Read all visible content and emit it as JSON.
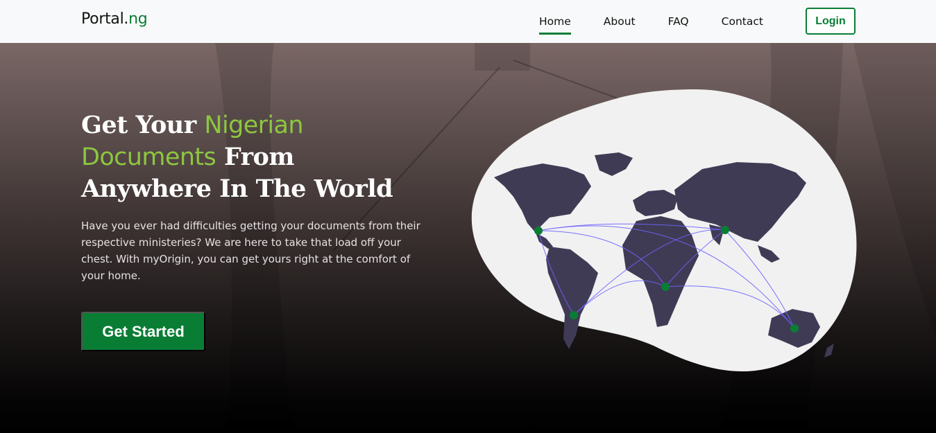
{
  "brand": {
    "name_main": "Portal.",
    "name_accent": "ng"
  },
  "nav": {
    "items": [
      {
        "label": "Home",
        "active": true
      },
      {
        "label": "About",
        "active": false
      },
      {
        "label": "FAQ",
        "active": false
      },
      {
        "label": "Contact",
        "active": false
      }
    ],
    "login_label": "Login"
  },
  "hero": {
    "headline_part1": "Get Your ",
    "headline_highlight1": "Nigerian",
    "headline_highlight2": "Documents",
    "headline_part2": " From",
    "headline_part3": "Anywhere In The World",
    "lead": "Have you ever had difficulties getting your documents from their respective ministeries? We are here to take that load off your chest. With myOrigin, you can get yours right at the comfort of your home.",
    "cta_label": "Get Started"
  },
  "illustration": {
    "icon": "world-map-illustration"
  },
  "colors": {
    "brand_green": "#0a7d35",
    "highlight_green": "#8dc63f",
    "map_land": "#403b55",
    "map_blob": "#f1f1f1",
    "route_lines": "#6c63ff"
  }
}
